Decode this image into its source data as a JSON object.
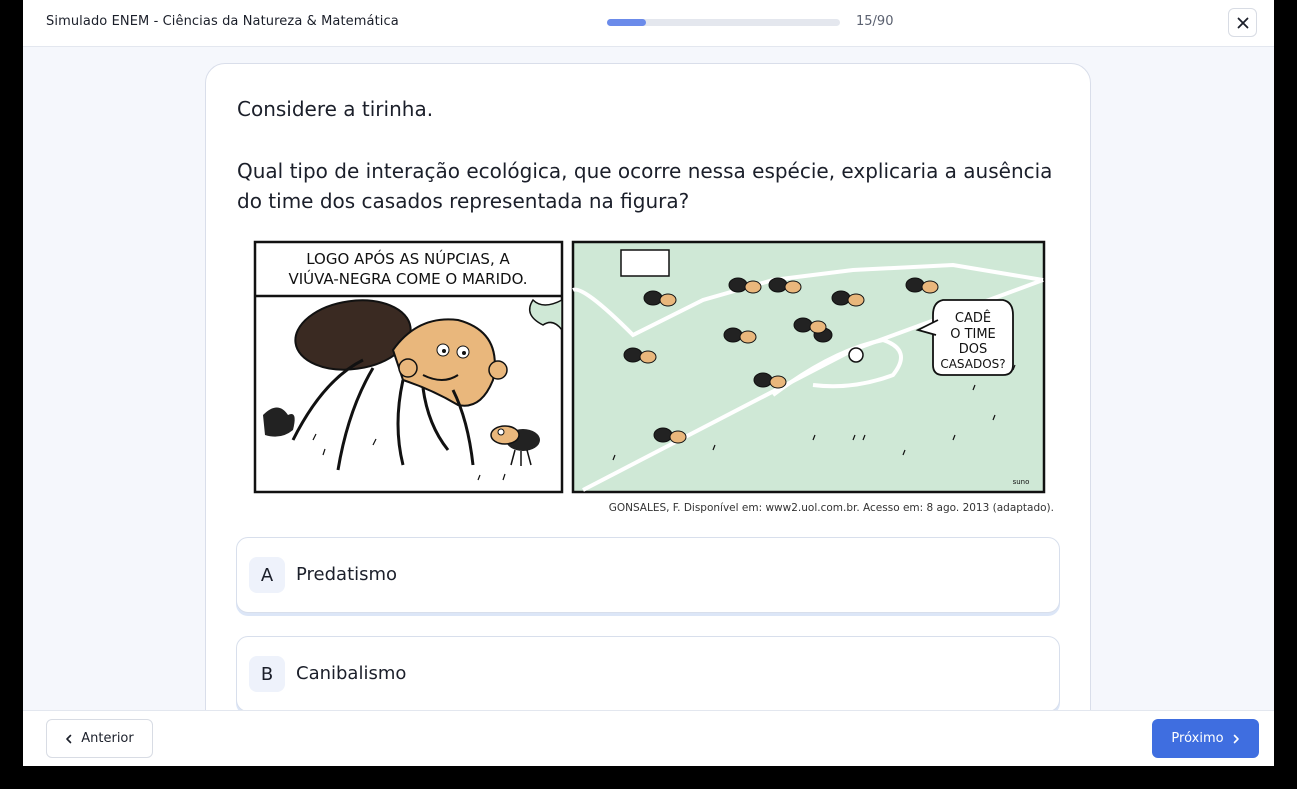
{
  "header": {
    "title": "Simulado ENEM - Ciências da Natureza & Matemática",
    "progress_fraction": 0.1667,
    "counter": "15/90",
    "close_icon": "close-icon"
  },
  "question": {
    "intro": "Considere a tirinha.",
    "text": "Qual tipo de interação ecológica, que ocorre nessa espécie, explicaria a ausência do time dos casados representada na figura?",
    "comic": {
      "panel1_caption_line1": "LOGO APÓS AS NÚPCIAS, A",
      "panel1_caption_line2": "VIÚVA-NEGRA COME O MARIDO.",
      "panel2_speech_line1": "CADÊ",
      "panel2_speech_line2": "O TIME",
      "panel2_speech_line3": "DOS",
      "panel2_speech_line4": "CASADOS?",
      "signature": "suno"
    },
    "credit": "GONSALES, F. Disponível em: www2.uol.com.br. Acesso em: 8 ago. 2013 (adaptado)."
  },
  "options": [
    {
      "letter": "A",
      "text": "Predatismo"
    },
    {
      "letter": "B",
      "text": "Canibalismo"
    }
  ],
  "footer": {
    "prev_label": "Anterior",
    "next_label": "Próximo"
  },
  "colors": {
    "accent": "#3f6ee0",
    "progress": "#6b8bea",
    "field_green": "#cfe8d6"
  }
}
